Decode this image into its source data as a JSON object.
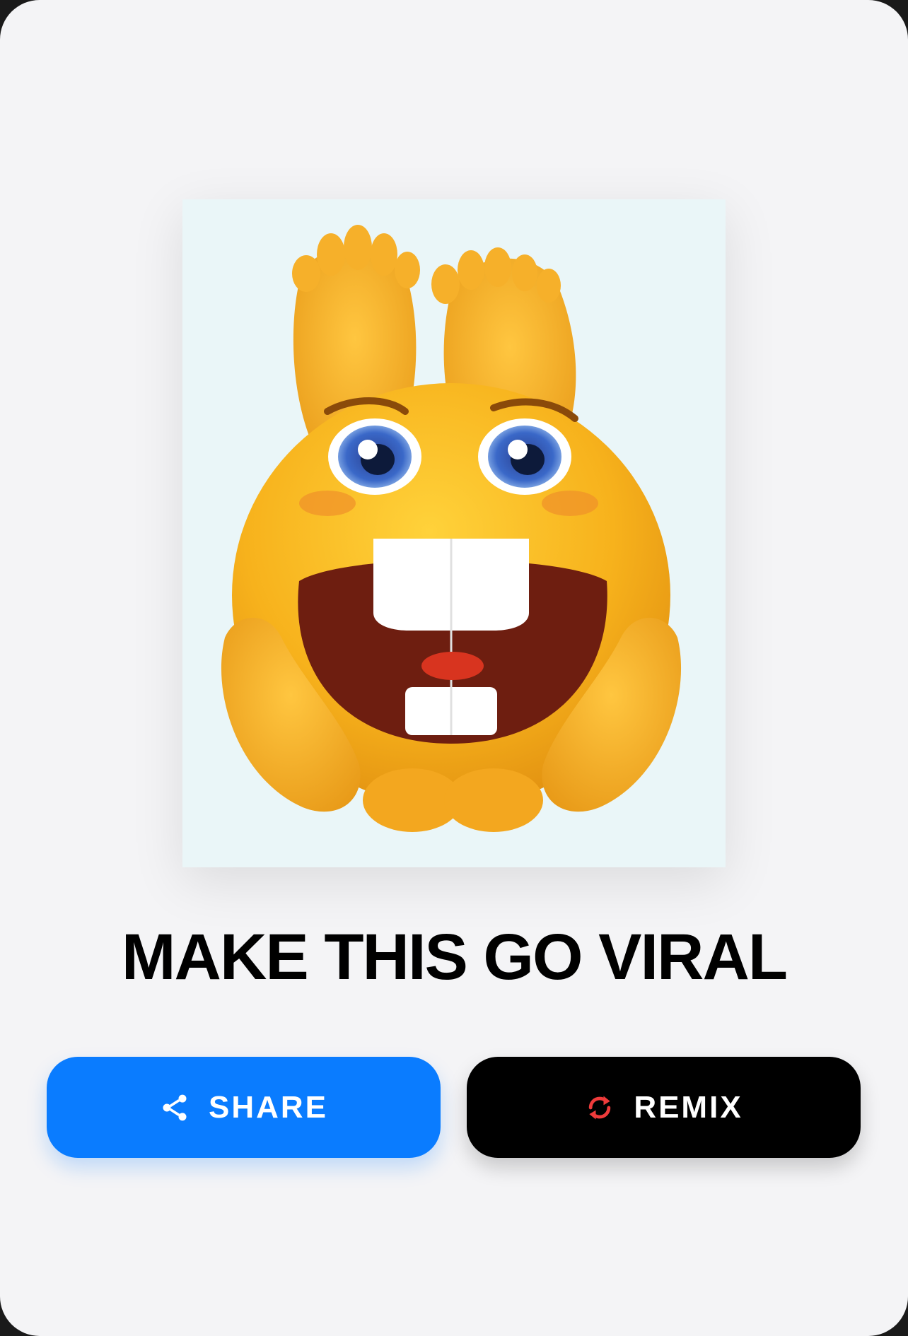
{
  "card": {
    "headline": "MAKE THIS GO VIRAL"
  },
  "image": {
    "subject": "emoji-laughing-feet",
    "background_color": "#eaf6f8"
  },
  "actions": {
    "share_label": "SHARE",
    "share_icon": "share-icon",
    "share_color": "#0a7cff",
    "remix_label": "REMIX",
    "remix_icon": "refresh-icon",
    "remix_color": "#000000",
    "remix_icon_color": "#ef3b3b"
  }
}
